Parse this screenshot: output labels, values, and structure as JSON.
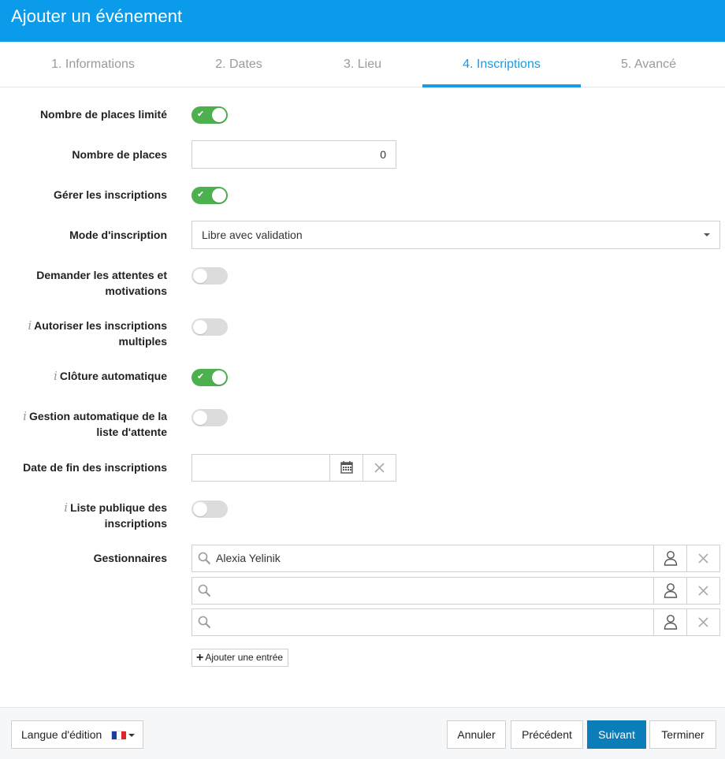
{
  "header": {
    "title": "Ajouter un événement"
  },
  "tabs": [
    {
      "label": "1. Informations",
      "active": false
    },
    {
      "label": "2. Dates",
      "active": false
    },
    {
      "label": "3. Lieu",
      "active": false
    },
    {
      "label": "4. Inscriptions",
      "active": true
    },
    {
      "label": "5. Avancé",
      "active": false
    }
  ],
  "form": {
    "limited_places": {
      "label": "Nombre de places limité",
      "on": true
    },
    "places_count": {
      "label": "Nombre de places",
      "value": "0"
    },
    "manage_registrations": {
      "label": "Gérer les inscriptions",
      "on": true
    },
    "registration_mode": {
      "label": "Mode d'inscription",
      "value": "Libre avec validation"
    },
    "ask_expectations": {
      "label_line1": "Demander les attentes et",
      "label_line2": "motivations",
      "on": false
    },
    "allow_multiple": {
      "info": "i",
      "label_line1": "Autoriser les inscriptions",
      "label_line2": "multiples",
      "on": false
    },
    "auto_close": {
      "info": "i",
      "label": "Clôture automatique",
      "on": true
    },
    "auto_waitlist": {
      "info": "i",
      "label_line1": "Gestion automatique de la",
      "label_line2": "liste d'attente",
      "on": false
    },
    "end_date": {
      "label": "Date de fin des inscriptions",
      "value": ""
    },
    "public_list": {
      "info": "i",
      "label_line1": "Liste publique des",
      "label_line2": "inscriptions",
      "on": false
    },
    "managers": {
      "label": "Gestionnaires",
      "entries": [
        {
          "value": "Alexia Yelinik"
        },
        {
          "value": ""
        },
        {
          "value": ""
        }
      ],
      "add_label": "Ajouter une entrée"
    }
  },
  "footer": {
    "language_label": "Langue d'édition",
    "language_flag": "france-flag-icon",
    "cancel_label": "Annuler",
    "previous_label": "Précédent",
    "next_label": "Suivant",
    "finish_label": "Terminer"
  },
  "colors": {
    "header_bg": "#0a9bea",
    "active_tab": "#1a9ae3",
    "toggle_on": "#4cb04f",
    "toggle_off": "#dcdcdc",
    "primary_button": "#0b7db8"
  }
}
